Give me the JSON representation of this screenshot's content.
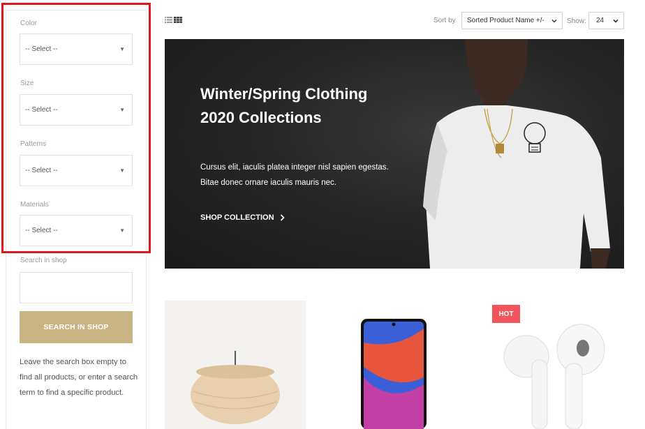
{
  "sidebar": {
    "filters": [
      {
        "label": "Color",
        "value": "-- Select --"
      },
      {
        "label": "Size",
        "value": "-- Select --"
      },
      {
        "label": "Patterns",
        "value": "-- Select --"
      },
      {
        "label": "Materials",
        "value": "-- Select --"
      }
    ],
    "search_label": "Search in shop",
    "search_value": "",
    "search_button": "SEARCH IN SHOP",
    "help_text": "Leave the search box empty to find all products, or enter a search term to find a specific product."
  },
  "toolbar": {
    "sort_label": "Sort by",
    "sort_value": "Sorted Product Name +/-",
    "show_label": "Show:",
    "show_value": "24",
    "view_icons": [
      "list-view-icon",
      "grid-view-icon"
    ]
  },
  "hero": {
    "title": "Winter/Spring Clothing 2020 Collections",
    "text": "Cursus elit, iaculis platea integer nisl sapien egestas. Bitae donec ornare iaculis mauris nec.",
    "link": "SHOP COLLECTION"
  },
  "products": [
    {
      "image": "pendant-lamp",
      "badge": ""
    },
    {
      "image": "smartphone",
      "badge": ""
    },
    {
      "image": "wireless-earbuds",
      "badge": "HOT"
    }
  ],
  "colors": {
    "accent": "#c8b483",
    "highlight": "#e0161b",
    "badge": "#f2545b",
    "hero_bg": "#262626"
  }
}
